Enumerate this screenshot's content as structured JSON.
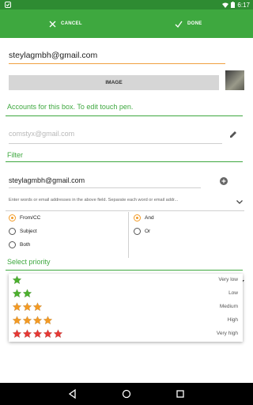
{
  "statusbar": {
    "time": "6:17"
  },
  "actionbar": {
    "cancel_label": "CANCEL",
    "done_label": "DONE"
  },
  "form": {
    "email_value": "steylagmbh@gmail.com",
    "image_button_label": "IMAGE",
    "accounts_title": "Accounts for this box. To edit touch pen.",
    "account_placeholder": "comstyx@gmail.com",
    "filter_title": "Filter",
    "filter_email_value": "steylagmbh@gmail.com",
    "filter_hint": "Enter words or email addresses in the above field. Separate each word or email addr...",
    "radios_left": [
      {
        "label": "From/CC",
        "selected": true
      },
      {
        "label": "Subject",
        "selected": false
      },
      {
        "label": "Both",
        "selected": false
      }
    ],
    "radios_right": [
      {
        "label": "And",
        "selected": true
      },
      {
        "label": "Or",
        "selected": false
      }
    ],
    "priority_title": "Select priority"
  },
  "priority_options": [
    {
      "label": "Very low",
      "stars": 1,
      "color": "#4caf2e"
    },
    {
      "label": "Low",
      "stars": 2,
      "color": "#4caf2e"
    },
    {
      "label": "Medium",
      "stars": 3,
      "color": "#f29a25"
    },
    {
      "label": "High",
      "stars": 4,
      "color": "#f29a25"
    },
    {
      "label": "Very high",
      "stars": 5,
      "color": "#e53935"
    }
  ],
  "colors": {
    "primary": "#3ea83f",
    "primary_dark": "#2e8b32",
    "accent": "#f29a25"
  },
  "icons": [
    "check-icon",
    "close-icon",
    "pen-icon",
    "add-circle-icon",
    "chevron-down-icon",
    "star-icon",
    "back-icon",
    "home-icon",
    "recents-icon"
  ]
}
